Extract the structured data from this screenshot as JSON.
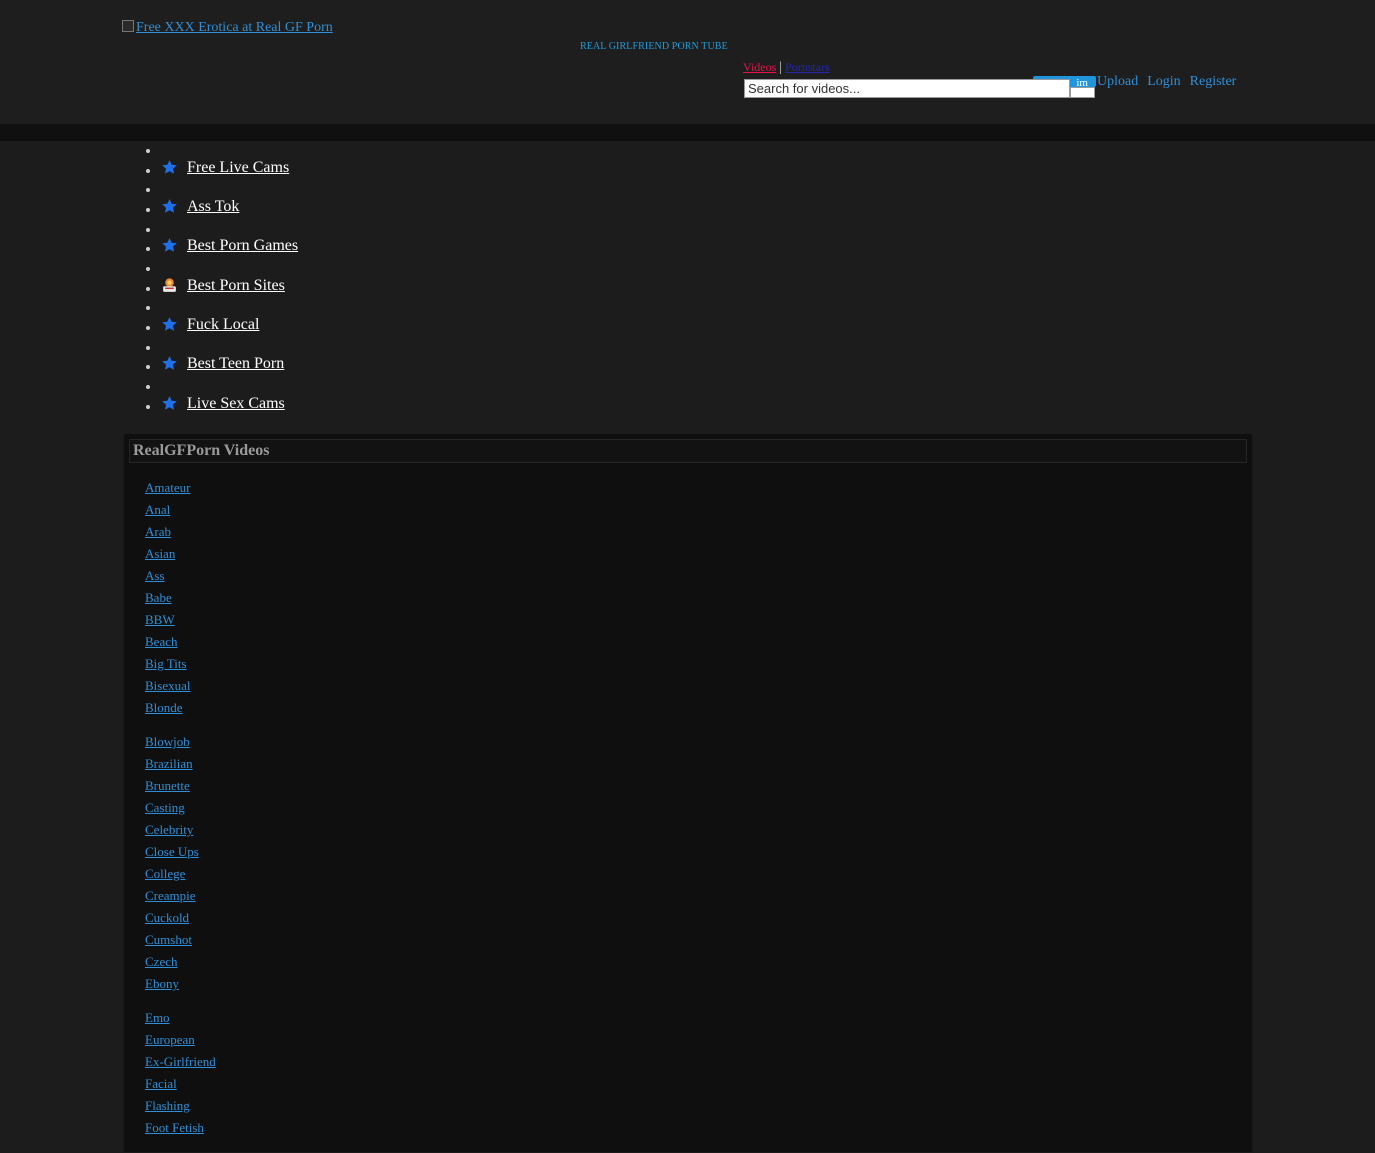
{
  "header": {
    "logo_alt": "Free XXX Erotica at Real GF Porn",
    "tagline": "REAL GIRLFRIEND PORN TUBE",
    "search_tabs": {
      "videos": "Videos",
      "separator": "|",
      "pornstars": "Pornstars"
    },
    "search": {
      "placeholder": "Search for videos...",
      "value": ""
    },
    "premium_label": "im",
    "user_links": [
      "Upload",
      "Login",
      "Register"
    ]
  },
  "promo_links": [
    {
      "icon": "star-icon",
      "label": "Free Live Cams"
    },
    {
      "icon": "star-icon",
      "label": "Ass Tok"
    },
    {
      "icon": "star-icon",
      "label": "Best Porn Games"
    },
    {
      "icon": "porn-sites-logo-icon",
      "label": "Best Porn Sites"
    },
    {
      "icon": "star-icon",
      "label": "Fuck Local"
    },
    {
      "icon": "star-icon",
      "label": "Best Teen Porn"
    },
    {
      "icon": "star-icon",
      "label": "Live Sex Cams"
    }
  ],
  "videos_panel": {
    "title": "RealGFPorn Videos",
    "category_columns": [
      [
        "Amateur",
        "Anal",
        "Arab",
        "Asian",
        "Ass",
        "Babe",
        "BBW",
        "Beach",
        "Big Tits",
        "Bisexual",
        "Blonde"
      ],
      [
        "Blowjob",
        "Brazilian",
        "Brunette",
        "Casting",
        "Celebrity",
        "Close Ups",
        "College",
        "Creampie",
        "Cuckold",
        "Cumshot",
        "Czech",
        "Ebony"
      ],
      [
        "Emo",
        "European",
        "Ex-Girlfriend",
        "Facial",
        "Flashing",
        "Foot Fetish"
      ]
    ]
  },
  "colors": {
    "background": "#1c1c1c",
    "header_bg": "#1e1e1e",
    "nav_bar_bg": "#101010",
    "panel_bg": "#0f0f0f",
    "link_blue": "#2f8fd8",
    "accent_blue": "#1f95de",
    "videos_tab_red": "#e8124a",
    "star_blue": "#1f6fe8"
  }
}
